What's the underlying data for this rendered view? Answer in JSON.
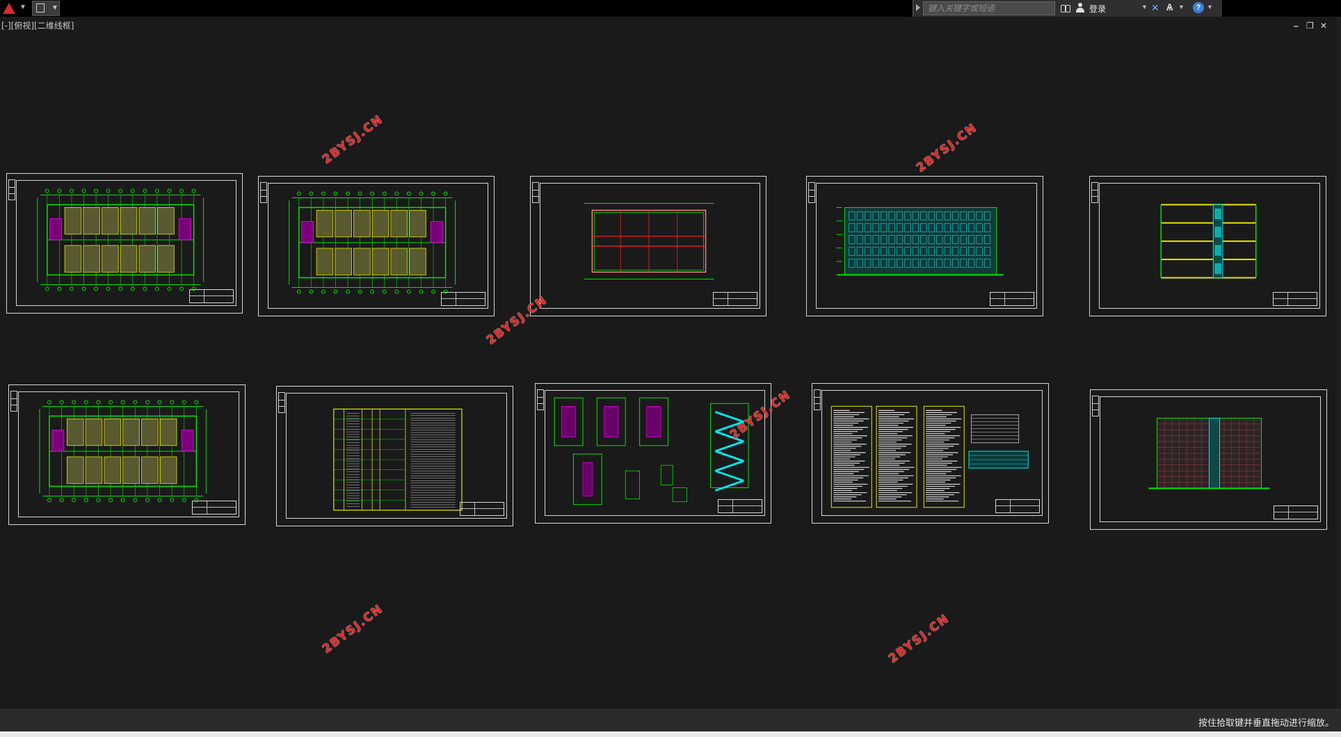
{
  "titlebar": {
    "search_placeholder": "键入关键字或短语",
    "login_label": "登录",
    "help_label": "?"
  },
  "viewport": {
    "label": "[-][俯视][二维线框]"
  },
  "window_controls": {
    "minimize": "‒",
    "restore": "❐",
    "close": "✕"
  },
  "watermark_text": "2BYSJ.CN",
  "status": {
    "message": "按住拾取键并垂直拖动进行缩放。"
  },
  "colors": {
    "canvas": "#1a1a1a",
    "drawing_green": "#00e600",
    "drawing_yellow": "#e6e600",
    "drawing_magenta": "#ff00ff",
    "drawing_cyan": "#00e6e6",
    "drawing_red": "#ff2020",
    "watermark": "#e12323"
  },
  "sheets": [
    {
      "kind": "floor-plan"
    },
    {
      "kind": "floor-plan"
    },
    {
      "kind": "roof-plan"
    },
    {
      "kind": "elevation-front"
    },
    {
      "kind": "section"
    },
    {
      "kind": "floor-plan"
    },
    {
      "kind": "door-window-table"
    },
    {
      "kind": "stair-details"
    },
    {
      "kind": "design-notes"
    },
    {
      "kind": "elevation-side"
    }
  ]
}
